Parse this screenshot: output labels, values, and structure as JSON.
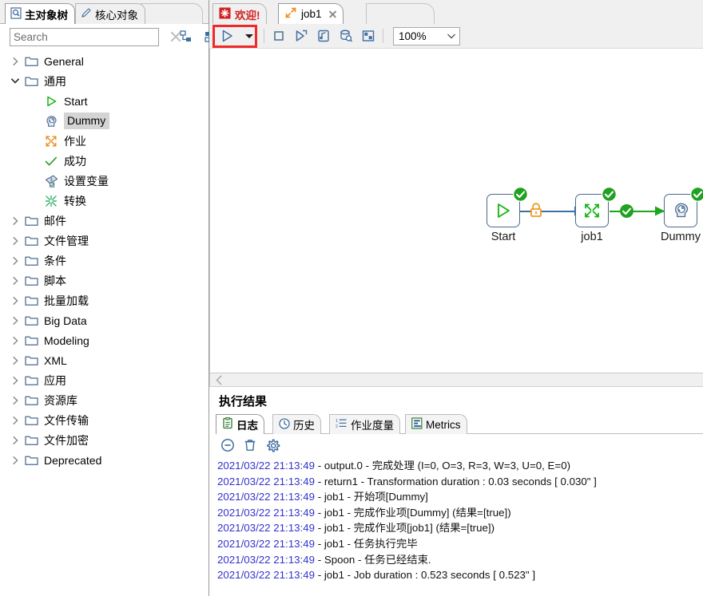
{
  "sidebar": {
    "tabs": [
      {
        "label": "主对象树",
        "icon": "document-tree-icon",
        "active": true
      },
      {
        "label": "核心对象",
        "icon": "pencil-icon",
        "active": false
      }
    ],
    "search": {
      "placeholder": "Search",
      "value": ""
    },
    "toolbar_icons": [
      {
        "name": "collapse-all-icon"
      },
      {
        "name": "view-menu-icon"
      }
    ],
    "tree": [
      {
        "label": "General",
        "icon": "folder-icon",
        "twisty": "collapsed",
        "depth": 0,
        "selected": false
      },
      {
        "label": "通用",
        "icon": "folder-icon",
        "twisty": "expanded",
        "depth": 0,
        "selected": false
      },
      {
        "label": "Start",
        "icon": "start-triangle-icon",
        "twisty": "none",
        "depth": 1,
        "selected": false
      },
      {
        "label": "Dummy",
        "icon": "dummy-head-icon",
        "twisty": "none",
        "depth": 1,
        "selected": true
      },
      {
        "label": "作业",
        "icon": "job-arrows-icon",
        "twisty": "none",
        "depth": 1,
        "selected": false
      },
      {
        "label": "成功",
        "icon": "check-icon",
        "twisty": "none",
        "depth": 1,
        "selected": false
      },
      {
        "label": "设置变量",
        "icon": "set-variable-icon",
        "twisty": "none",
        "depth": 1,
        "selected": false
      },
      {
        "label": "转换",
        "icon": "transform-icon",
        "twisty": "none",
        "depth": 1,
        "selected": false
      },
      {
        "label": "邮件",
        "icon": "folder-icon",
        "twisty": "collapsed",
        "depth": 0,
        "selected": false
      },
      {
        "label": "文件管理",
        "icon": "folder-icon",
        "twisty": "collapsed",
        "depth": 0,
        "selected": false
      },
      {
        "label": "条件",
        "icon": "folder-icon",
        "twisty": "collapsed",
        "depth": 0,
        "selected": false
      },
      {
        "label": "脚本",
        "icon": "folder-icon",
        "twisty": "collapsed",
        "depth": 0,
        "selected": false
      },
      {
        "label": "批量加载",
        "icon": "folder-icon",
        "twisty": "collapsed",
        "depth": 0,
        "selected": false
      },
      {
        "label": "Big Data",
        "icon": "folder-icon",
        "twisty": "collapsed",
        "depth": 0,
        "selected": false
      },
      {
        "label": "Modeling",
        "icon": "folder-icon",
        "twisty": "collapsed",
        "depth": 0,
        "selected": false
      },
      {
        "label": "XML",
        "icon": "folder-icon",
        "twisty": "collapsed",
        "depth": 0,
        "selected": false
      },
      {
        "label": "应用",
        "icon": "folder-icon",
        "twisty": "collapsed",
        "depth": 0,
        "selected": false
      },
      {
        "label": "资源库",
        "icon": "folder-icon",
        "twisty": "collapsed",
        "depth": 0,
        "selected": false
      },
      {
        "label": "文件传输",
        "icon": "folder-icon",
        "twisty": "collapsed",
        "depth": 0,
        "selected": false
      },
      {
        "label": "文件加密",
        "icon": "folder-icon",
        "twisty": "collapsed",
        "depth": 0,
        "selected": false
      },
      {
        "label": "Deprecated",
        "icon": "folder-icon",
        "twisty": "collapsed",
        "depth": 0,
        "selected": false
      }
    ]
  },
  "editor": {
    "tabs": [
      {
        "label": "欢迎!",
        "icon": "welcome-icon",
        "active": false,
        "closable": false
      },
      {
        "label": "job1",
        "icon": "job-arrows-icon",
        "active": true,
        "closable": true
      }
    ],
    "toolbar": {
      "run_label": "run-button",
      "run_dropdown_label": "run-options-dropdown",
      "items": [
        {
          "name": "run-button",
          "icon": "play-triangle-icon"
        },
        {
          "name": "run-options-dropdown",
          "icon": "caret-down-icon"
        },
        {
          "name": "stop-button",
          "icon": "stop-square-icon"
        },
        {
          "name": "preview-button",
          "icon": "play-step-icon"
        },
        {
          "name": "debug-button",
          "icon": "debug-note-icon"
        },
        {
          "name": "replay-button",
          "icon": "db-inspect-icon"
        },
        {
          "name": "schedule-button",
          "icon": "grid-preview-icon"
        }
      ],
      "zoom": {
        "value": "100%",
        "caret": "chevron-down-icon"
      }
    },
    "highlight": {
      "color": "#ef2a2a",
      "target": "run-button"
    }
  },
  "canvas": {
    "nodes": [
      {
        "id": "start",
        "label": "Start",
        "icon": "start-triangle-icon",
        "status": "success"
      },
      {
        "id": "job1",
        "label": "job1",
        "icon": "job-arrows-icon",
        "status": "success"
      },
      {
        "id": "dummy",
        "label": "Dummy",
        "icon": "dummy-head-icon",
        "status": "success"
      }
    ],
    "hops": [
      {
        "from": "start",
        "to": "job1",
        "color": "#3f6ea1",
        "marker": "lock-icon"
      },
      {
        "from": "job1",
        "to": "dummy",
        "color": "#1aa81a",
        "marker": "check-circle-icon"
      }
    ],
    "scrollbar": {
      "left_arrow": "chevron-left-icon"
    }
  },
  "results": {
    "title": "执行结果",
    "tabs": [
      {
        "label": "日志",
        "icon": "clipboard-icon",
        "active": true
      },
      {
        "label": "历史",
        "icon": "clock-icon",
        "active": false
      },
      {
        "label": "作业度量",
        "icon": "list-order-icon",
        "active": false
      },
      {
        "label": "Metrics",
        "icon": "bar-chart-icon",
        "active": false
      }
    ],
    "toolbar": [
      {
        "name": "clear-log-button",
        "icon": "minus-circle-icon"
      },
      {
        "name": "delete-log-button",
        "icon": "trash-icon"
      },
      {
        "name": "log-settings-button",
        "icon": "gear-icon"
      }
    ],
    "log_lines": [
      {
        "ts": "2021/03/22 21:13:49",
        "msg": " - output.0 - 完成处理 (I=0, O=3, R=3, W=3, U=0, E=0)"
      },
      {
        "ts": "2021/03/22 21:13:49",
        "msg": " - return1 - Transformation duration : 0.03 seconds [  0.030\" ]"
      },
      {
        "ts": "2021/03/22 21:13:49",
        "msg": " - job1 - 开始项[Dummy]"
      },
      {
        "ts": "2021/03/22 21:13:49",
        "msg": " - job1 - 完成作业项[Dummy] (结果=[true])"
      },
      {
        "ts": "2021/03/22 21:13:49",
        "msg": " - job1 - 完成作业项[job1] (结果=[true])"
      },
      {
        "ts": "2021/03/22 21:13:49",
        "msg": " - job1 - 任务执行完毕"
      },
      {
        "ts": "2021/03/22 21:13:49",
        "msg": " - Spoon - 任务已经结束."
      },
      {
        "ts": "2021/03/22 21:13:49",
        "msg": " - job1 - Job duration : 0.523 seconds [  0.523\" ]"
      }
    ]
  },
  "colors": {
    "success_green": "#21a121",
    "hop_blue": "#3f6ea1",
    "lock_orange": "#f29a1f",
    "highlight_red": "#ef2a2a",
    "timestamp_blue": "#3333cc",
    "node_border": "#4b6a8e"
  }
}
